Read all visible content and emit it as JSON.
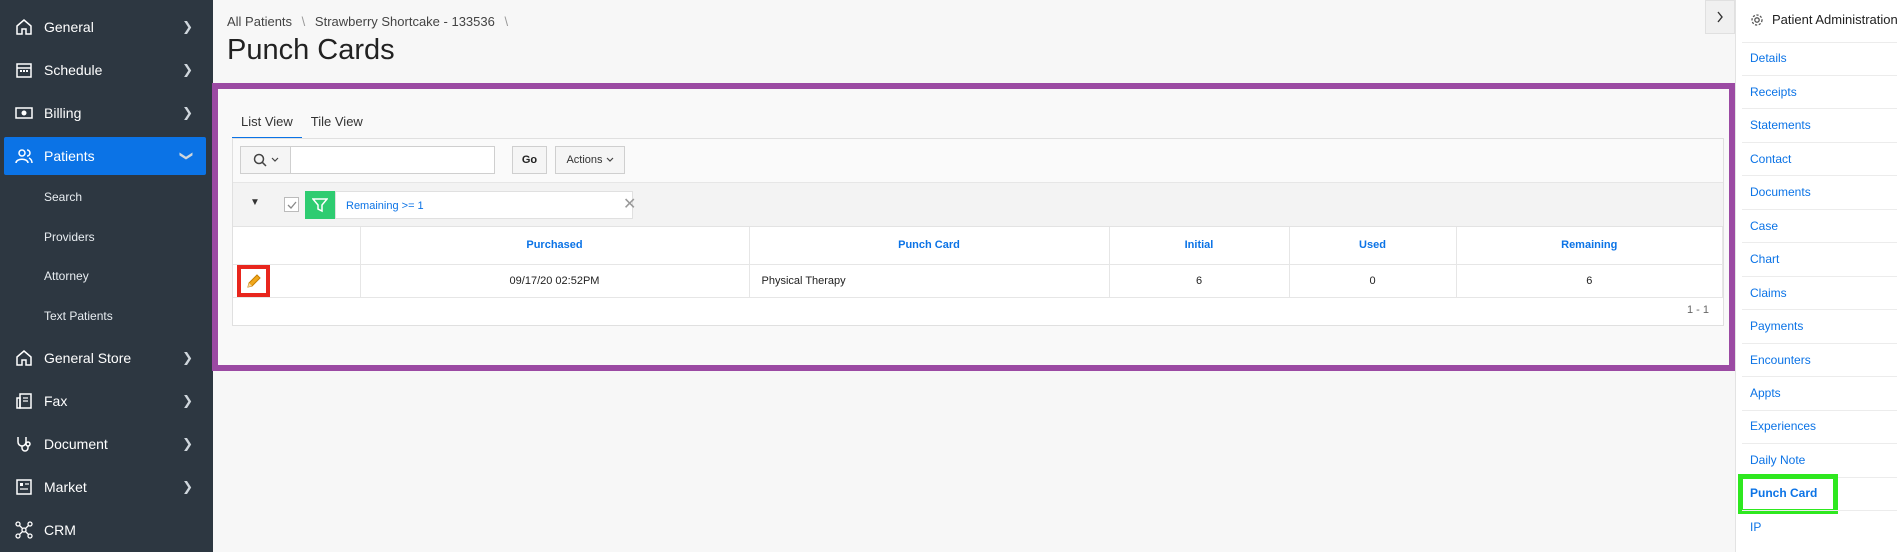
{
  "nav": {
    "items": [
      {
        "label": "General",
        "icon": "home-icon"
      },
      {
        "label": "Schedule",
        "icon": "calendar-icon"
      },
      {
        "label": "Billing",
        "icon": "money-icon"
      },
      {
        "label": "Patients",
        "icon": "users-icon"
      },
      {
        "label": "General Store",
        "icon": "store-icon"
      },
      {
        "label": "Fax",
        "icon": "fax-icon"
      },
      {
        "label": "Document",
        "icon": "stethoscope-icon"
      },
      {
        "label": "Market",
        "icon": "market-icon"
      },
      {
        "label": "CRM",
        "icon": "network-icon"
      }
    ],
    "patients_sub": [
      "Search",
      "Providers",
      "Attorney",
      "Text Patients"
    ]
  },
  "breadcrumb": {
    "root": "All Patients",
    "current": "Strawberry Shortcake - 133536",
    "sep": "\\"
  },
  "page_title": "Punch Cards",
  "tabs": [
    "List View",
    "Tile View"
  ],
  "toolbar": {
    "search_value": "",
    "go_label": "Go",
    "actions_label": "Actions"
  },
  "filter": {
    "text": "Remaining >= 1"
  },
  "table": {
    "columns": [
      "",
      "Purchased",
      "Punch Card",
      "Initial",
      "Used",
      "Remaining"
    ],
    "rows": [
      {
        "purchased": "09/17/20 02:52PM",
        "punch_card": "Physical Therapy",
        "initial": "6",
        "used": "0",
        "remaining": "6"
      }
    ],
    "pager": "1 - 1"
  },
  "right_panel": {
    "title": "Patient Administration",
    "links": [
      "Details",
      "Receipts",
      "Statements",
      "Contact",
      "Documents",
      "Case",
      "Chart",
      "Claims",
      "Payments",
      "Encounters",
      "Appts",
      "Experiences",
      "Daily Note",
      "Punch Card",
      "IP"
    ],
    "active": "Punch Card"
  },
  "colors": {
    "nav_bg": "#2d3741",
    "nav_active": "#0b73e6",
    "link": "#0b73e6",
    "region_border": "#9b4aa3",
    "highlight_green": "#2ee81f",
    "highlight_red": "#e8261d",
    "filter_green": "#2ecc71"
  }
}
